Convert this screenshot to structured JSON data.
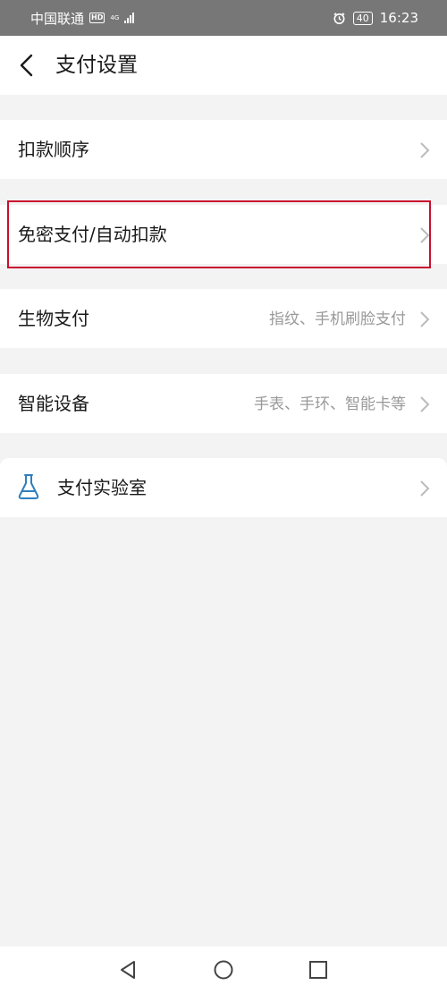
{
  "status_bar": {
    "carrier": "中国联通",
    "hd": "HD",
    "network": "4G",
    "battery": "40",
    "time": "16:23"
  },
  "header": {
    "title": "支付设置"
  },
  "items": [
    {
      "label": "扣款顺序",
      "value": ""
    },
    {
      "label": "免密支付/自动扣款",
      "value": ""
    },
    {
      "label": "生物支付",
      "value": "指纹、手机刷脸支付"
    },
    {
      "label": "智能设备",
      "value": "手表、手环、智能卡等"
    }
  ],
  "lab": {
    "label": "支付实验室"
  },
  "colors": {
    "status_bar": "#777777",
    "background": "#f3f3f3",
    "highlight": "#c8102e",
    "accent": "#2f7fbf"
  },
  "icons": {
    "back": "back-arrow-icon",
    "chevron": "chevron-right-icon",
    "lab": "flask-icon",
    "nav_back": "triangle-back-icon",
    "nav_home": "circle-home-icon",
    "nav_recent": "square-recent-icon"
  }
}
